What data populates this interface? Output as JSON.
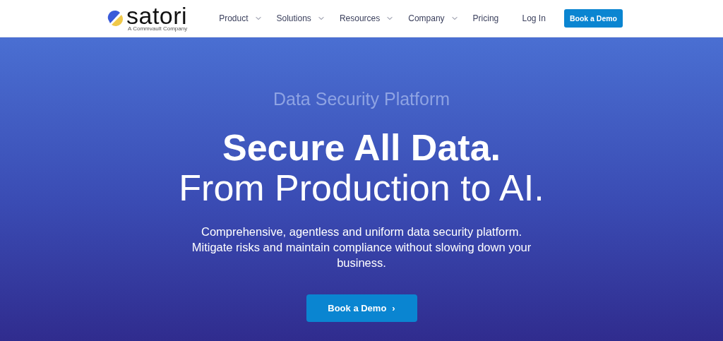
{
  "header": {
    "logo": {
      "name": "satori",
      "tagline": "A Commvault Company"
    },
    "nav": [
      {
        "label": "Product",
        "has_menu": true
      },
      {
        "label": "Solutions",
        "has_menu": true
      },
      {
        "label": "Resources",
        "has_menu": true
      },
      {
        "label": "Company",
        "has_menu": true
      },
      {
        "label": "Pricing",
        "has_menu": false
      }
    ],
    "login": "Log In",
    "cta": "Book a Demo"
  },
  "hero": {
    "eyebrow": "Data Security Platform",
    "title_bold": "Secure All Data.",
    "title_light": "From Production to AI.",
    "description": "Comprehensive, agentless and uniform data security platform. Mitigate risks and maintain compliance without slowing down your business.",
    "cta": "Book a Demo",
    "cta_arrow": "›"
  }
}
